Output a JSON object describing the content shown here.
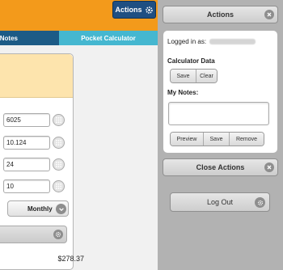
{
  "header": {
    "actions_label": "Actions"
  },
  "tabs": {
    "notes": "Notes",
    "calculator": "Pocket Calculator"
  },
  "calculator": {
    "fields": [
      "6025",
      "10.124",
      "24",
      "10"
    ],
    "frequency": "Monthly",
    "total": "$278.37"
  },
  "drawer": {
    "title": "Actions",
    "logged_in_label": "Logged in as:",
    "calculator_data_title": "Calculator Data",
    "save_label": "Save",
    "clear_label": "Clear",
    "notes_title": "My Notes:",
    "notes_value": "",
    "preview_label": "Preview",
    "notes_save_label": "Save",
    "remove_label": "Remove",
    "close_label": "Close Actions",
    "logout_label": "Log Out"
  },
  "colors": {
    "topbar": "#f39a1b",
    "accent_blue": "#1f4f82",
    "tab_active": "#45b7d0",
    "result_bg": "#fde4ad"
  }
}
